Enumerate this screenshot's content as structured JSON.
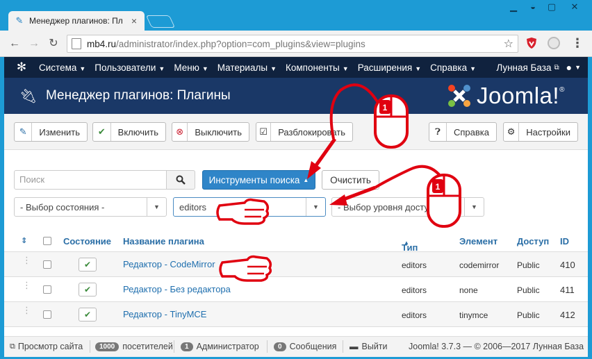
{
  "browser": {
    "tab_title": "Менеджер плагинов: Пл",
    "url_host": "mb4.ru",
    "url_path": "/administrator/index.php?option=com_plugins&view=plugins"
  },
  "admin_menu": {
    "items": [
      "Система",
      "Пользователи",
      "Меню",
      "Материалы",
      "Компоненты",
      "Расширения",
      "Справка"
    ],
    "site_name": "Лунная База"
  },
  "header": {
    "title": "Менеджер плагинов: Плагины",
    "brand": "Joomla!",
    "brand_mark": "®"
  },
  "toolbar": {
    "edit": "Изменить",
    "enable": "Включить",
    "disable": "Выключить",
    "unlock": "Разблокировать",
    "help": "Справка",
    "options": "Настройки"
  },
  "search": {
    "placeholder": "Поиск",
    "tools_label": "Инструменты поиска",
    "clear_label": "Очистить"
  },
  "filters": {
    "state": "- Выбор состояния -",
    "folder": "editors",
    "access": "- Выбор уровня доступа -"
  },
  "table": {
    "headers": {
      "status": "Состояние",
      "name": "Название плагина",
      "type": "Тип",
      "element": "Элемент",
      "access": "Доступ",
      "id": "ID"
    },
    "rows": [
      {
        "name": "Редактор - CodeMirror",
        "type": "editors",
        "element": "codemirror",
        "access": "Public",
        "id": "410"
      },
      {
        "name": "Редактор - Без редактора",
        "type": "editors",
        "element": "none",
        "access": "Public",
        "id": "411"
      },
      {
        "name": "Редактор - TinyMCE",
        "type": "editors",
        "element": "tinymce",
        "access": "Public",
        "id": "412"
      }
    ]
  },
  "status_bar": {
    "view_site": "Просмотр сайта",
    "visitors_count": "1000",
    "visitors_label": "посетителей",
    "admins_count": "1",
    "admins_label": "Администратор",
    "messages_count": "0",
    "messages_label": "Сообщения",
    "logout": "Выйти",
    "version": "Joomla! 3.7.3 — © 2006—2017 Лунная База"
  },
  "annotations": {
    "mouse_button_number": "1"
  },
  "colors": {
    "browser_chrome": "#1d9bd5",
    "admin_bar": "#10223e",
    "header_bar": "#1a3867",
    "primary_button": "#2f85c8",
    "link": "#1f6fae",
    "annotation": "#e00010"
  }
}
